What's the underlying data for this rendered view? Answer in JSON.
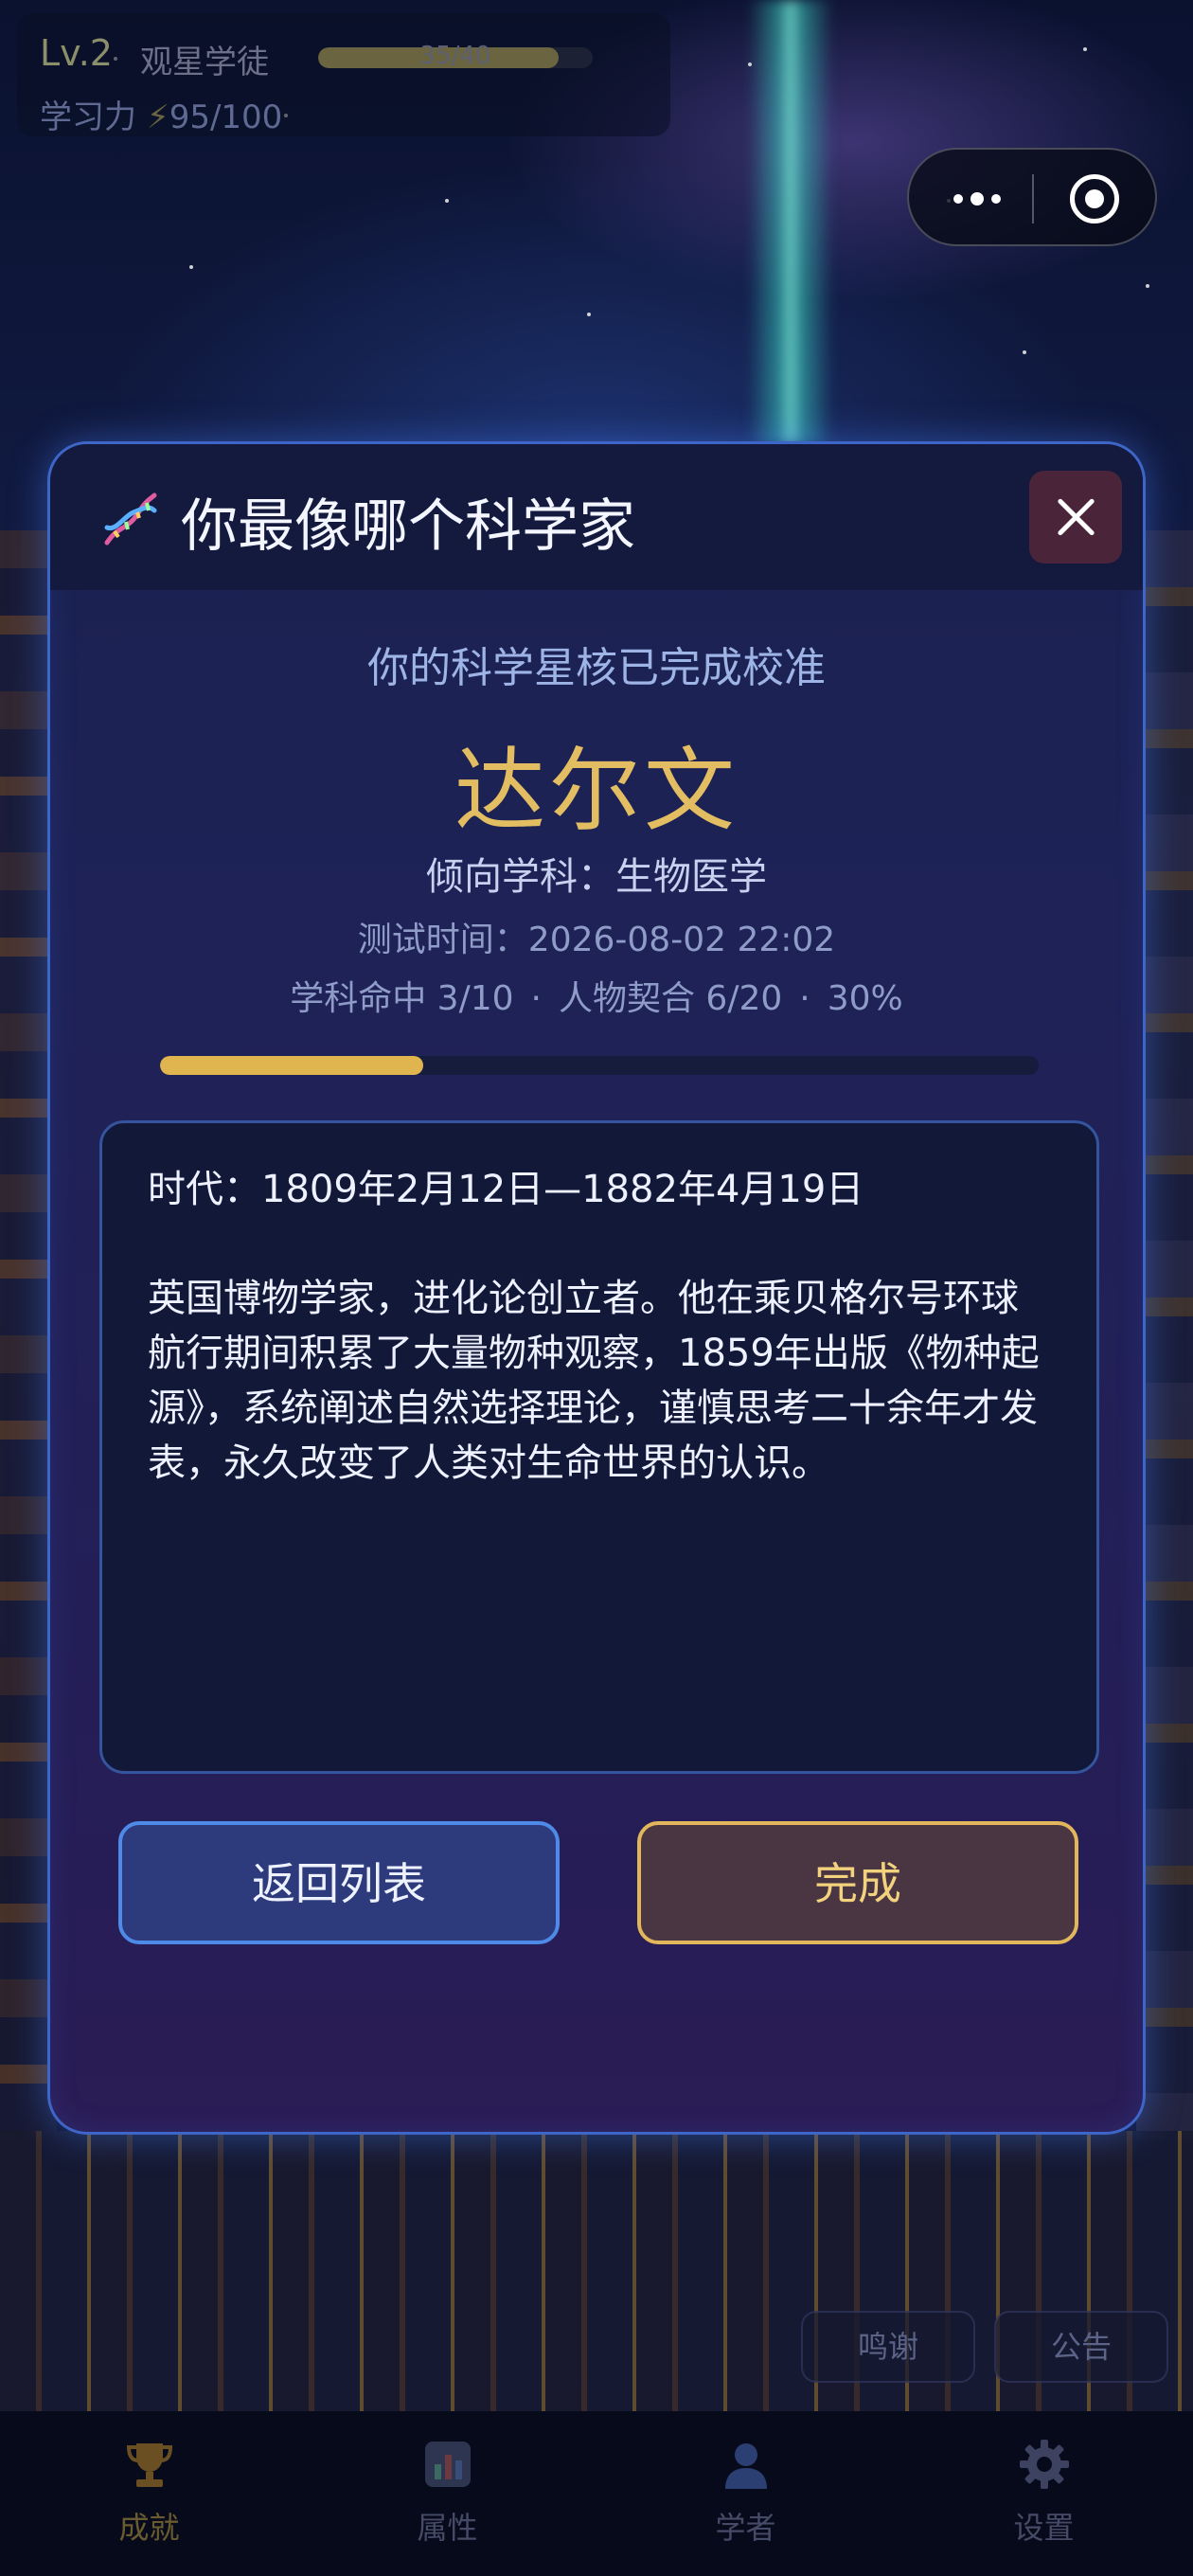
{
  "hud": {
    "level": "Lv.2",
    "rank": "观星学徒",
    "xp_text": "35/40",
    "xp_progress": 0.875,
    "power_label": "学习力",
    "power_icon": "⚡",
    "power_value": "95/100"
  },
  "capsule": {
    "more_icon": "more-dots-icon",
    "close_icon": "target-icon"
  },
  "modal": {
    "title": "你最像哪个科学家",
    "subtitle": "你的科学星核已完成校准",
    "scientist_name": "达尔文",
    "discipline": "倾向学科：生物医学",
    "test_time": "测试时间：2026-08-02 22:02",
    "stats": {
      "discipline_hit": "学科命中 3/10",
      "person_match": "人物契合 6/20",
      "percent": "30%",
      "separator": "·"
    },
    "progress": 0.3,
    "era": "时代：1809年2月12日—1882年4月19日",
    "description": "英国博物学家，进化论创立者。他在乘贝格尔号环球航行期间积累了大量物种观察，1859年出版《物种起源》，系统阐述自然选择理论，谨慎思考二十余年才发表，永久改变了人类对生命世界的认识。",
    "back_button": "返回列表",
    "done_button": "完成"
  },
  "footer_buttons": {
    "thanks": "鸣谢",
    "notice": "公告"
  },
  "tabs": [
    {
      "label": "成就",
      "icon": "trophy-icon"
    },
    {
      "label": "属性",
      "icon": "bar-chart-icon"
    },
    {
      "label": "学者",
      "icon": "person-icon"
    },
    {
      "label": "设置",
      "icon": "gear-icon"
    }
  ],
  "colors": {
    "accent_gold": "#e3bd62",
    "accent_blue": "#4e8ae8",
    "modal_border": "#3e66c8"
  }
}
